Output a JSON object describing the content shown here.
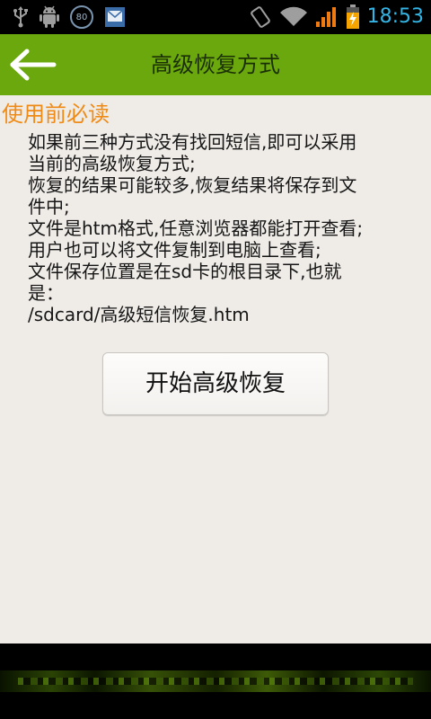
{
  "status_bar": {
    "time": "18:53",
    "badge": "80",
    "colors": {
      "time": "#33b5e5",
      "icons": "#9e9e9e",
      "battery_fill": "#f5a400",
      "signal_fill": "#f07a12"
    },
    "icons": [
      "usb-icon",
      "android-debug-icon",
      "badge-80-icon",
      "sms-notify-icon",
      "rotation-icon",
      "wifi-icon",
      "signal-icon",
      "battery-charging-icon"
    ]
  },
  "titlebar": {
    "title": "高级恢复方式",
    "back_icon": "arrow-left-icon",
    "color": "#6aa80d"
  },
  "content": {
    "heading": "使用前必读",
    "heading_color": "#f08a16",
    "lines": [
      "如果前三种方式没有找回短信,即可以采用",
      "当前的高级恢复方式;",
      "恢复的结果可能较多,恢复结果将保存到文",
      "件中;",
      "文件是htm格式,任意浏览器都能打开查看;",
      "用户也可以将文件复制到电脑上查看;",
      "文件保存位置是在sd卡的根目录下,也就",
      "是：",
      "/sdcard/高级短信恢复.htm"
    ],
    "start_button": "开始高级恢复"
  }
}
